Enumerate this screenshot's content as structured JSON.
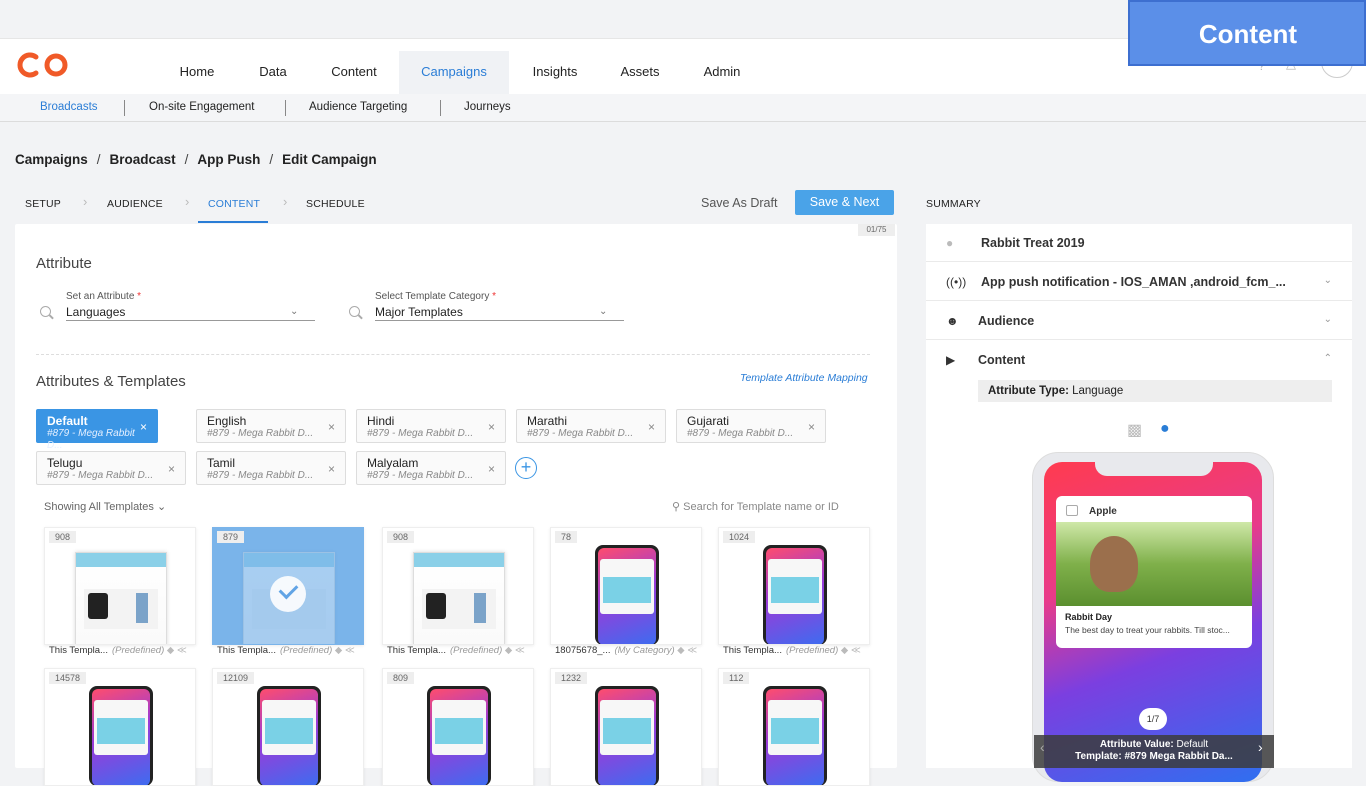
{
  "highlight_label": "Content",
  "nav": {
    "items": [
      {
        "label": "Home"
      },
      {
        "label": "Data"
      },
      {
        "label": "Content"
      },
      {
        "label": "Campaigns"
      },
      {
        "label": "Insights"
      },
      {
        "label": "Assets"
      },
      {
        "label": "Admin"
      }
    ],
    "active": "Campaigns"
  },
  "subnav": {
    "items": [
      {
        "label": "Broadcasts"
      },
      {
        "label": "On-site Engagement"
      },
      {
        "label": "Audience Targeting"
      },
      {
        "label": "Journeys"
      }
    ]
  },
  "breadcrumb": {
    "items": [
      "Campaigns",
      "Broadcast",
      "App Push",
      "Edit Campaign"
    ],
    "sep": "/"
  },
  "steps": {
    "items": [
      "SETUP",
      "AUDIENCE",
      "CONTENT",
      "SCHEDULE"
    ],
    "active": "CONTENT"
  },
  "actions": {
    "save_draft": "Save As Draft",
    "save_next": "Save & Next"
  },
  "counter": "01/75",
  "attribute": {
    "heading": "Attribute",
    "set_label": "Set an Attribute",
    "set_value": "Languages",
    "category_label": "Select Template Category",
    "category_value": "Major Templates",
    "required": "*"
  },
  "attrs_templates": {
    "heading": "Attributes & Templates",
    "mapping_link": "Template Attribute Mapping",
    "chips": [
      {
        "name": "Default",
        "tpl": "#879 - Mega Rabbit D...",
        "active": true
      },
      {
        "name": "English",
        "tpl": "#879 - Mega Rabbit D..."
      },
      {
        "name": "Hindi",
        "tpl": "#879 - Mega Rabbit D..."
      },
      {
        "name": "Marathi",
        "tpl": "#879 - Mega Rabbit D..."
      },
      {
        "name": "Gujarati",
        "tpl": "#879 - Mega Rabbit D..."
      },
      {
        "name": "Telugu",
        "tpl": "#879 - Mega Rabbit D..."
      },
      {
        "name": "Tamil",
        "tpl": "#879 - Mega Rabbit D..."
      },
      {
        "name": "Malyalam",
        "tpl": "#879 - Mega Rabbit D..."
      }
    ],
    "close_glyph": "×",
    "add_glyph": "+",
    "showing": "Showing All Templates",
    "search_placeholder": "Search for Template name or ID"
  },
  "templates": [
    {
      "id": "908",
      "name": "This Templa...",
      "cat": "(Predefined)",
      "kind": "flat"
    },
    {
      "id": "879",
      "name": "This Templa...",
      "cat": "(Predefined)",
      "kind": "selected"
    },
    {
      "id": "908",
      "name": "This Templa...",
      "cat": "(Predefined)",
      "kind": "flat"
    },
    {
      "id": "78",
      "name": "18075678_...",
      "cat": "(My Category)",
      "kind": "phone"
    },
    {
      "id": "1024",
      "name": "This Templa...",
      "cat": "(Predefined)",
      "kind": "phone"
    },
    {
      "id": "14578",
      "kind": "phone"
    },
    {
      "id": "12109",
      "kind": "phone"
    },
    {
      "id": "809",
      "kind": "phone"
    },
    {
      "id": "1232",
      "kind": "phone"
    },
    {
      "id": "112",
      "kind": "phone"
    }
  ],
  "summary": {
    "label": "SUMMARY",
    "campaign_name": "Rabbit Treat 2019",
    "channel": "App push notification - IOS_AMAN ,android_fcm_...",
    "audience": "Audience",
    "content": "Content",
    "attr_type_key": "Attribute Type:",
    "attr_type_val": "Language",
    "preview": {
      "app": "Apple",
      "title": "Rabbit Day",
      "body": "The best day to treat your rabbits. Till stoc...",
      "pager": "1/7",
      "attr_value_key": "Attribute Value:",
      "attr_value": "Default",
      "template_key": "Template:",
      "template": "#879 Mega Rabbit Da..."
    }
  },
  "colors": {
    "accent": "#2a7dd6",
    "brand_logo": "#f05a28",
    "save_next": "#4aa3e8",
    "highlight": "#5b8fe8"
  }
}
